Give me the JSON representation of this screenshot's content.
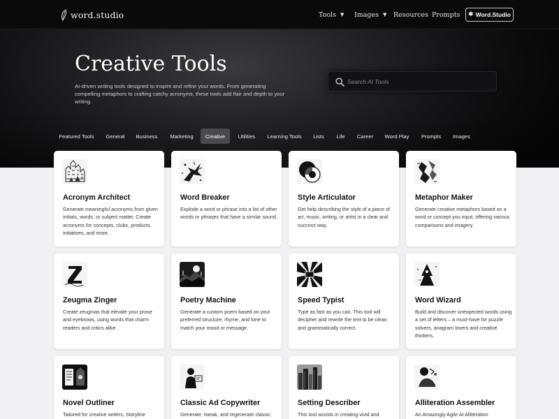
{
  "brand": {
    "name": "word.studio"
  },
  "nav": {
    "items": [
      {
        "label": "Tools",
        "has_dropdown": true
      },
      {
        "label": "Images",
        "has_dropdown": true
      },
      {
        "label": "Resources",
        "has_dropdown": false
      },
      {
        "label": "Prompts",
        "has_dropdown": false
      }
    ],
    "cta": {
      "icon": "gear-icon",
      "label": "Word.Studio"
    }
  },
  "hero": {
    "title": "Creative Tools",
    "description": "AI-driven writing tools designed to inspire and refine your words. From generating compelling metaphors to crafting catchy acronyms, these tools add flair and depth to your writing."
  },
  "search": {
    "placeholder": "Search AI Tools",
    "value": "",
    "icon": "search-icon"
  },
  "tabs": [
    {
      "label": "Featured Tools",
      "active": false
    },
    {
      "label": "General",
      "active": false
    },
    {
      "label": "Business",
      "active": false
    },
    {
      "label": "Marketing",
      "active": false
    },
    {
      "label": "Creative",
      "active": true
    },
    {
      "label": "Utilities",
      "active": false
    },
    {
      "label": "Learning Tools",
      "active": false
    },
    {
      "label": "Lists",
      "active": false
    },
    {
      "label": "Life",
      "active": false
    },
    {
      "label": "Career",
      "active": false
    },
    {
      "label": "Word Play",
      "active": false
    },
    {
      "label": "Prompts",
      "active": false
    },
    {
      "label": "Images",
      "active": false
    }
  ],
  "cards": [
    {
      "title": "Acronym Architect",
      "description": "Generate meaningful acronyms from given initials, words, or subject matter. Create acronyms for concepts, clubs, products, initiatives, and more.",
      "icon": "city-sketch-icon"
    },
    {
      "title": "Word Breaker",
      "description": "Explode a word or phrase into a list of other words or phrases that have a similar sound.",
      "icon": "exploding-word-icon"
    },
    {
      "title": "Style Articulator",
      "description": "Get help describing the style of a piece of art, music, writing, or artist in a clear and succinct way.",
      "icon": "abstract-circles-icon"
    },
    {
      "title": "Metaphor Maker",
      "description": "Generate creative metaphors based on a word or concept you input, offering various comparisons and imagery.",
      "icon": "abstract-figure-icon"
    },
    {
      "title": "Zeugma Zinger",
      "description": "Create zeugmas that elevate your prose and eyebrows, using words that charm readers and critics alike.",
      "icon": "letter-z-icon"
    },
    {
      "title": "Poetry Machine",
      "description": "Generate a custom poem based on your preferred structure, rhyme, and tone to match your mood or message.",
      "icon": "moonlit-landscape-icon"
    },
    {
      "title": "Speed Typist",
      "description": "Type as fast as you can. This tool will decipher and rewrite the text to be clean and grammatically correct.",
      "icon": "speed-rays-icon"
    },
    {
      "title": "Word Wizard",
      "description": "Build and discover unexpected words using a set of letters – a must-have for puzzle solvers, anagram lovers and creative thinkers.",
      "icon": "wizard-icon"
    },
    {
      "title": "Novel Outliner",
      "description": "Tailored for creative writers, Storyline",
      "icon": "book-scene-icon"
    },
    {
      "title": "Classic Ad Copywriter",
      "description": "Generate, tweak, and regenerate classic",
      "icon": "vintage-ad-icon"
    },
    {
      "title": "Setting Describer",
      "description": "This tool assists in creating vivid and",
      "icon": "city-skyline-icon"
    },
    {
      "title": "Alliteration Assembler",
      "description": "An Amazingly Agile AI Alliteration",
      "icon": "alliteration-figure-icon"
    }
  ]
}
